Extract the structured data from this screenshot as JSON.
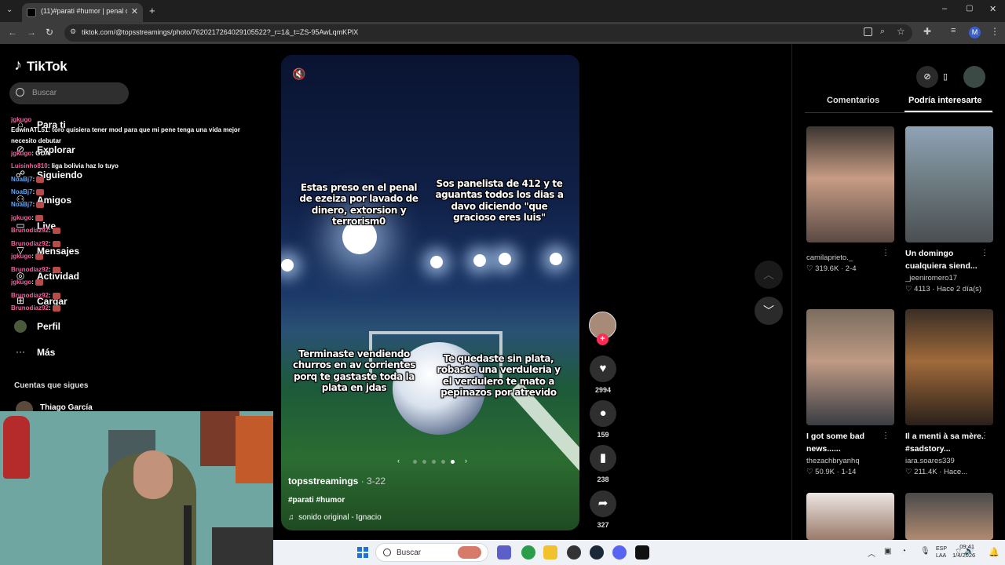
{
  "browser": {
    "tab_title": "(11)#parati #humor | penal car...",
    "url": "tiktok.com/@topsstreamings/photo/7620217264029105522?_r=1&_t=ZS-95AwLqmKPlX",
    "profile_initial": "M"
  },
  "sidebar": {
    "brand": "TikTok",
    "search_placeholder": "Buscar",
    "items": [
      {
        "label": "Para ti",
        "icon": "home-icon"
      },
      {
        "label": "Explorar",
        "icon": "compass-icon"
      },
      {
        "label": "Siguiendo",
        "icon": "following-icon"
      },
      {
        "label": "Amigos",
        "icon": "friends-icon"
      },
      {
        "label": "Live",
        "icon": "live-icon"
      },
      {
        "label": "Mensajes",
        "icon": "message-icon"
      },
      {
        "label": "Actividad",
        "icon": "activity-icon"
      },
      {
        "label": "Cargar",
        "icon": "upload-icon"
      },
      {
        "label": "Perfil",
        "icon": "profile-icon"
      },
      {
        "label": "Más",
        "icon": "more-icon"
      }
    ],
    "following_title": "Cuentas que sigues",
    "following_user": "Thiago García"
  },
  "chat": [
    {
      "user": "jgkugo",
      "msg": ""
    },
    {
      "user": "EdwinATL51",
      "msg": ": toro quisiera tener mod para que mi pene tenga una vida mejor"
    },
    {
      "user": "",
      "msg": "necesito debutar"
    },
    {
      "user": "jgkugo",
      "msg": ": GOA"
    },
    {
      "user": "Luisinho810",
      "msg": ": liga bolivia haz lo tuyo"
    },
    {
      "user": "NoaBj7",
      "msg": ":"
    },
    {
      "user": "NoaBj7",
      "msg": ":"
    },
    {
      "user": "NoaBj7",
      "msg": ":"
    },
    {
      "user": "jgkugo",
      "msg": ":"
    },
    {
      "user": "Brunodiaz92",
      "msg": ":"
    },
    {
      "user": "Brunodiaz92",
      "msg": ":"
    },
    {
      "user": "jgkugo",
      "msg": ":"
    },
    {
      "user": "Brunodiaz92",
      "msg": ":"
    },
    {
      "user": "jgkugo",
      "msg": ":"
    },
    {
      "user": "Brunodiaz92",
      "msg": ":"
    },
    {
      "user": "Brunodiaz92",
      "msg": ":"
    }
  ],
  "video": {
    "meme_top_left": "Estas preso en el penal de ezeiza por lavado de dinero, extorsion y terrorism0",
    "meme_top_right": "Sos panelista de 412 y te aguantas todos los dias a davo diciendo \"que gracioso eres luis\"",
    "meme_bottom_left": "Terminaste vendiendo churros en av corrientes porq te gastaste toda la plata en jdas",
    "meme_bottom_right": "Te quedaste sin plata, robaste una verduleria y el verdulero te mato a pepinazos por atrevido",
    "author": "topsstreamings",
    "date": " · 3-22",
    "tags": "#parati #humor",
    "sound": "sonido original - Ignacio"
  },
  "actions": {
    "likes": "2994",
    "comments": "159",
    "saves": "238",
    "shares": "327"
  },
  "right_panel": {
    "tabs": [
      "Comentarios",
      "Podría interesarte"
    ],
    "active_tab": "Podría interesarte",
    "cards": [
      {
        "caption": "",
        "author": "camilaprieto._",
        "likes": "319.6K",
        "date": "2-4"
      },
      {
        "caption": "Un domingo cualquiera siend...",
        "author": "_jeeniromero17",
        "likes": "4113",
        "date": "Hace 2 día(s)"
      },
      {
        "caption": "I got some bad news......",
        "author": "thezachbryanhq",
        "likes": "50.9K",
        "date": "1-14"
      },
      {
        "caption": "Il a menti à sa mère. #sadstory...",
        "author": "iara.soares339",
        "likes": "211.4K",
        "date": "Hace..."
      }
    ]
  },
  "taskbar": {
    "search_placeholder": "Buscar",
    "lang_top": "ESP",
    "lang_bottom": "LAA",
    "time": "09:41",
    "date": "1/4/2026"
  },
  "colors": {
    "accent": "#fe2c55",
    "background": "#000000"
  }
}
